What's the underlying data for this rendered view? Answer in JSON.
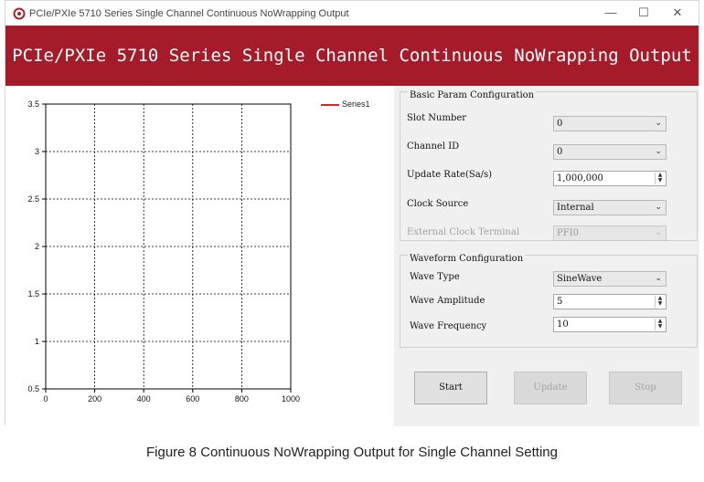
{
  "window": {
    "title": "PCIe/PXIe 5710 Series Single Channel Continuous NoWrapping Output",
    "minimize_glyph": "—",
    "maximize_glyph": "☐",
    "close_glyph": "✕"
  },
  "banner": {
    "text": "PCIe/PXIe 5710 Series Single Channel Continuous NoWrapping Output",
    "color": "#a61b29"
  },
  "chart_data": {
    "type": "line",
    "series": [
      {
        "name": "Series1",
        "values": [],
        "color": "#dd2222"
      }
    ],
    "x_ticks": [
      "0",
      "200",
      "400",
      "600",
      "800",
      "1000"
    ],
    "y_ticks": [
      "0.5",
      "1",
      "1.5",
      "2",
      "2.5",
      "3",
      "3.5"
    ],
    "xlim": [
      0,
      1000
    ],
    "ylim": [
      0.5,
      3.5
    ],
    "grid": true,
    "legend_position": "top-right"
  },
  "basic_param": {
    "title": "Basic Param Configuration",
    "slot_number": {
      "label": "Slot Number",
      "value": "0"
    },
    "channel_id": {
      "label": "Channel ID",
      "value": "0"
    },
    "update_rate": {
      "label": "Update Rate(Sa/s)",
      "value": "1,000,000"
    },
    "clock_source": {
      "label": "Clock Source",
      "value": "Internal"
    },
    "external_clock_terminal": {
      "label": "External Clock Terminal",
      "value": "PFI0"
    }
  },
  "waveform": {
    "title": "Waveform Configuration",
    "wave_type": {
      "label": "Wave Type",
      "value": "SineWave"
    },
    "wave_amplitude": {
      "label": "Wave Amplitude",
      "value": "5"
    },
    "wave_frequency": {
      "label": "Wave Frequency",
      "value": "10"
    }
  },
  "buttons": {
    "start": "Start",
    "update": "Update",
    "stop": "Stop"
  },
  "icons": {
    "dropdown": "⌄",
    "spin_up": "▲",
    "spin_down": "▼"
  },
  "caption": "Figure 8 Continuous NoWrapping Output for Single Channel Setting"
}
